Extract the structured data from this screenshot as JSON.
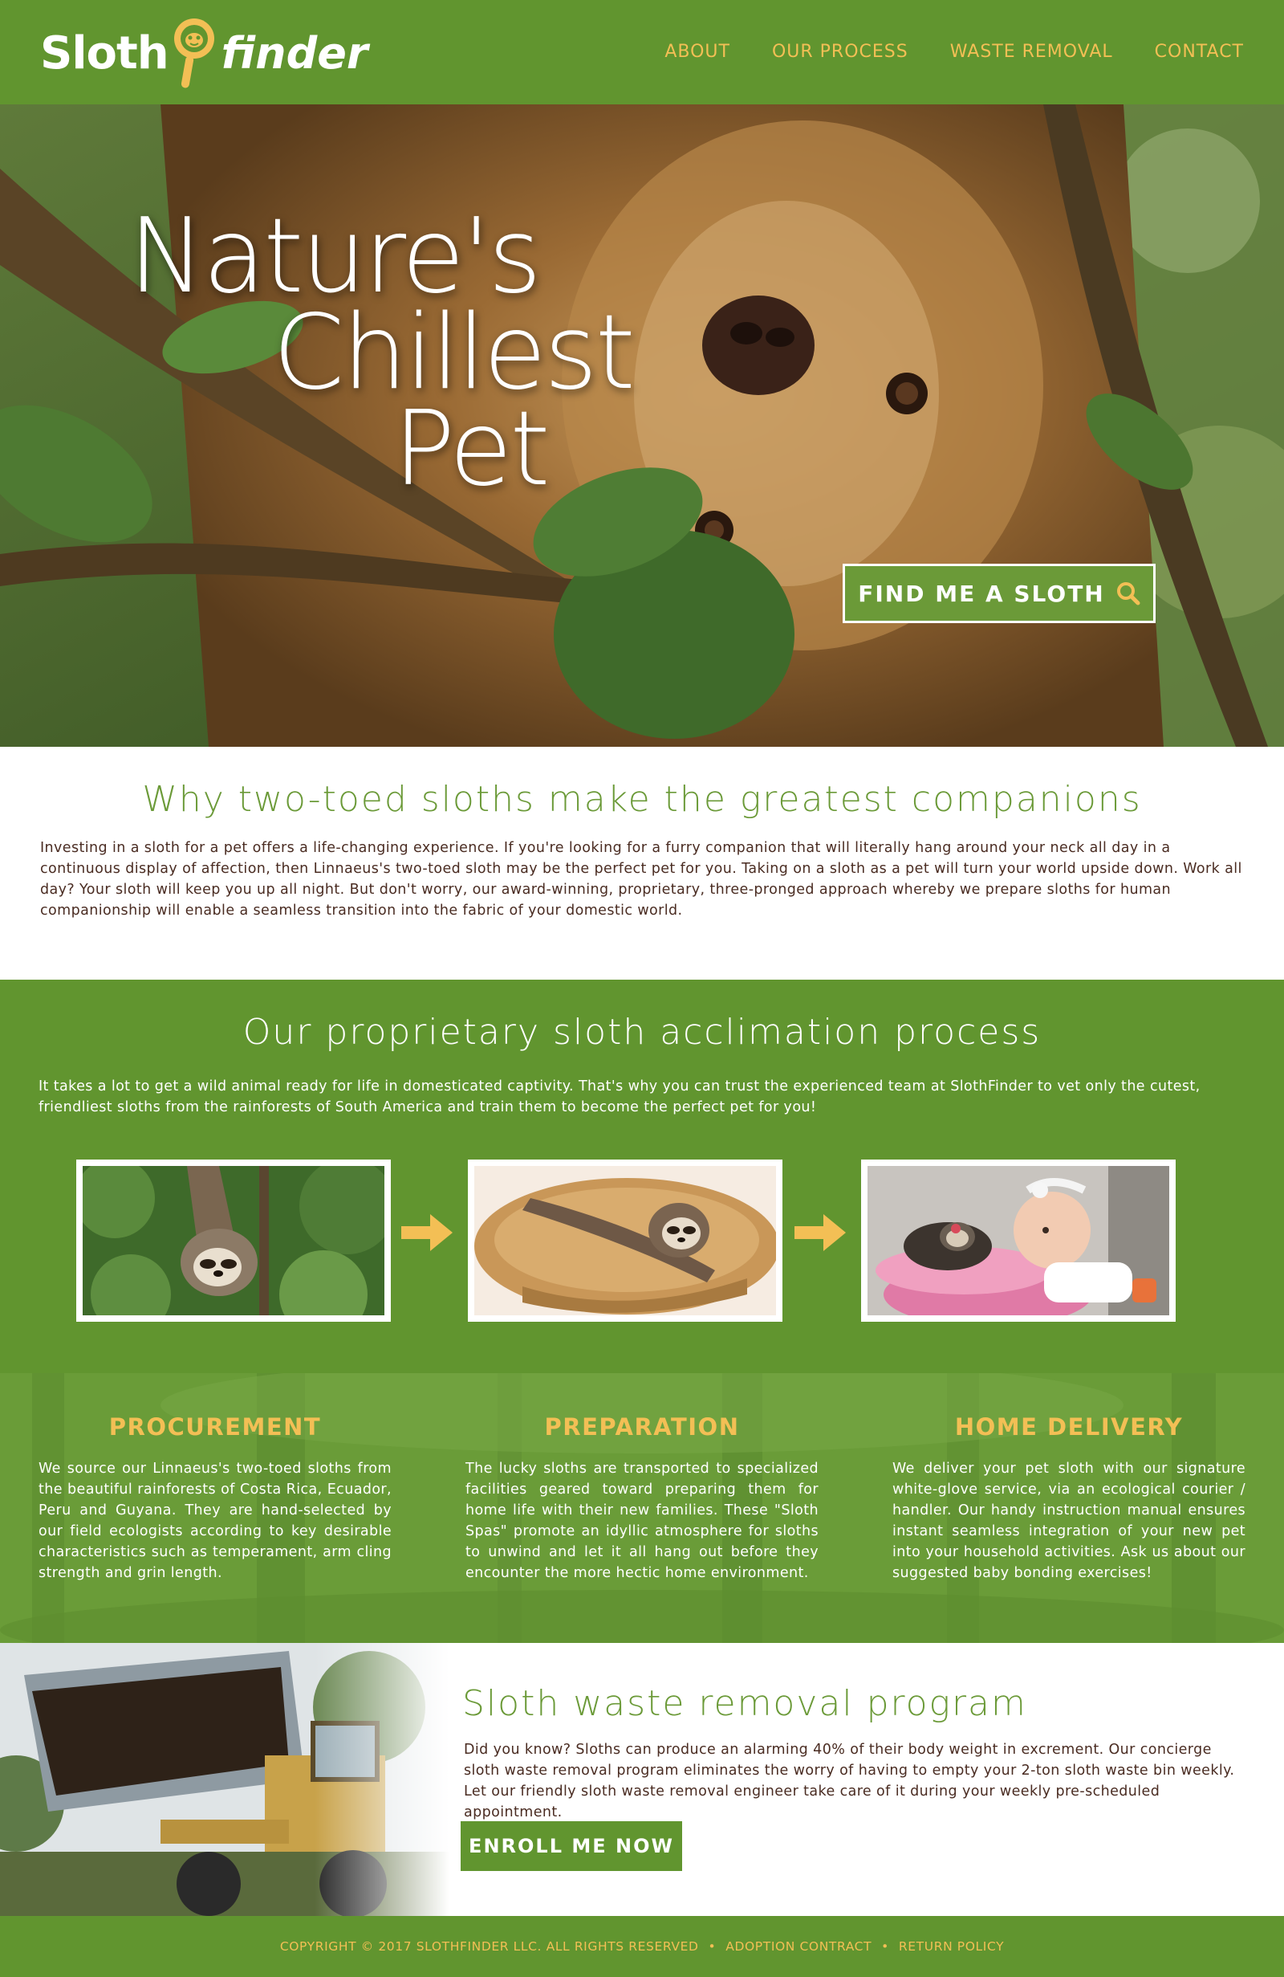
{
  "header": {
    "logo_left": "Sloth",
    "logo_right": "finder",
    "nav": [
      "ABOUT",
      "OUR PROCESS",
      "WASTE REMOVAL",
      "CONTACT"
    ]
  },
  "hero": {
    "title_lines": [
      "Nature's",
      "Chillest",
      "Pet"
    ],
    "cta_label": "FIND ME A SLOTH",
    "cta_icon": "search-icon"
  },
  "why": {
    "title": "Why two-toed sloths make the greatest companions",
    "body": "Investing in a sloth for a pet offers a life-changing experience. If you're looking for a furry companion that will literally hang around your neck all day in a continuous display of affection, then Linnaeus's two-toed sloth may be the perfect pet for you. Taking on a sloth as a pet will turn your world upside down. Work all day? Your sloth will keep you up all night. But don't worry, our award-winning, proprietary, three-pronged approach whereby we prepare sloths for human companionship will enable a seamless transition into the fabric of your domestic world."
  },
  "process": {
    "title": "Our proprietary sloth acclimation process",
    "body": "It takes a lot to get a wild animal ready for life in domesticated captivity. That's why you can trust the experienced team at SlothFinder to vet only the cutest, friendliest sloths from the rainforests of South America and train them to become the perfect pet for you!",
    "photos": [
      "sloth-in-tree-photo",
      "sloth-in-basket-photo",
      "sloth-with-baby-photo"
    ]
  },
  "steps": [
    {
      "title": "PROCUREMENT",
      "body": "We source our Linnaeus's two-toed sloths from the beautiful rainforests of Costa Rica, Ecuador, Peru and Guyana. They are hand-selected by our field ecologists according to key desirable characteristics such as temperament, arm cling strength and grin length."
    },
    {
      "title": "PREPARATION",
      "body": "The lucky sloths are transported to specialized facilities geared toward preparing them for home life with their new families. These \"Sloth Spas\" promote an idyllic atmosphere for sloths to unwind and let it all hang out before they encounter the more hectic home environment."
    },
    {
      "title": "HOME DELIVERY",
      "body": "We deliver your pet sloth with our signature white-glove service, via an ecological courier / handler. Our handy instruction manual ensures instant seamless integration of your new pet into your household activities. Ask us about our suggested baby bonding exercises!"
    }
  ],
  "waste": {
    "title": "Sloth waste removal program",
    "body": "Did you know? Sloths can produce an alarming 40% of their body weight in excrement. Our concierge sloth waste removal program eliminates the worry of having to empty your 2-ton sloth waste bin weekly. Let our friendly sloth waste removal engineer take care of it during your weekly pre-scheduled appointment.",
    "cta_label": "ENROLL ME NOW"
  },
  "footer": {
    "copyright": "COPYRIGHT © 2017 SLOTHFINDER LLC. ALL RIGHTS RESERVED",
    "sep": "•",
    "links": [
      "ADOPTION CONTRACT",
      "RETURN POLICY"
    ]
  },
  "colors": {
    "brand_green": "#61952f",
    "accent_gold": "#f3bf55",
    "text_brown": "#4a2c22"
  }
}
